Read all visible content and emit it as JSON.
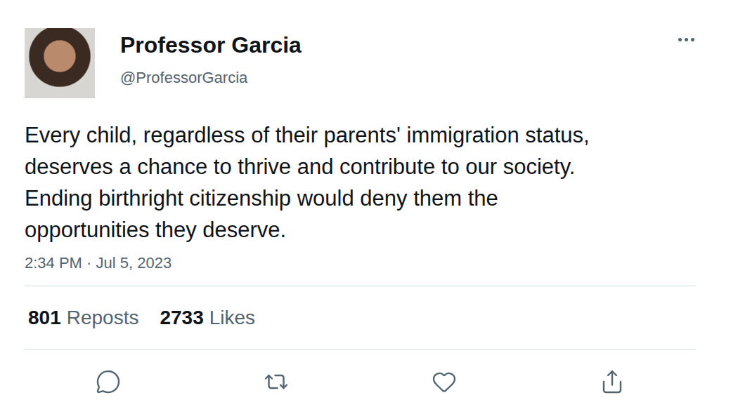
{
  "post": {
    "author": {
      "name": "Professor Garcia",
      "handle": "@ProfessorGarcia"
    },
    "text": "Every child, regardless of their parents' immigration status, deserves a chance to thrive and contribute to our society. Ending birthright citizenship would deny them the opportunities they deserve.",
    "timestamp": "2:34 PM · Jul 5, 2023"
  },
  "stats": [
    {
      "count": "801",
      "label": "Reposts"
    },
    {
      "count": "2733",
      "label": "Likes"
    }
  ],
  "actions": [
    {
      "kind": "reply"
    },
    {
      "kind": "repost"
    },
    {
      "kind": "like"
    },
    {
      "kind": "share"
    }
  ]
}
